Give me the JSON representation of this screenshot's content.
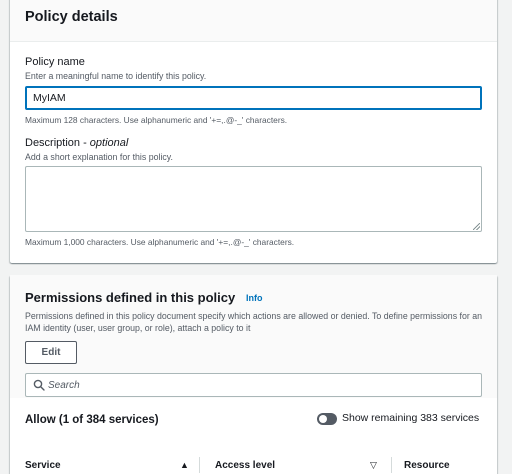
{
  "details": {
    "title": "Policy details",
    "policy_name": {
      "label": "Policy name",
      "description": "Enter a meaningful name to identify this policy.",
      "value": "MyIAM",
      "hint": "Maximum 128 characters. Use alphanumeric and '+=,.@-_' characters."
    },
    "description_field": {
      "label": "Description - ",
      "optional": "optional",
      "description": "Add a short explanation for this policy.",
      "value": "",
      "hint": "Maximum 1,000 characters. Use alphanumeric and '+=,.@-_' characters."
    }
  },
  "permissions": {
    "title": "Permissions defined in this policy",
    "info": "Info",
    "description": "Permissions defined in this policy document specify which actions are allowed or denied. To define permissions for an IAM identity (user, user group, or role), attach a policy to it",
    "edit_label": "Edit",
    "search_placeholder": "Search",
    "allow_title": "Allow (1 of 384 services)",
    "toggle_label": "Show remaining 383 services",
    "toggle_on": false,
    "columns": [
      "Service",
      "Access level",
      "Resource"
    ]
  },
  "colors": {
    "accent": "#0073bb",
    "background": "#f2f3f3",
    "text": "#16191f",
    "muted": "#545b64"
  },
  "icons": [
    "search-icon",
    "sort-ascending-icon",
    "sort-descending-icon",
    "resize-grip-icon"
  ]
}
